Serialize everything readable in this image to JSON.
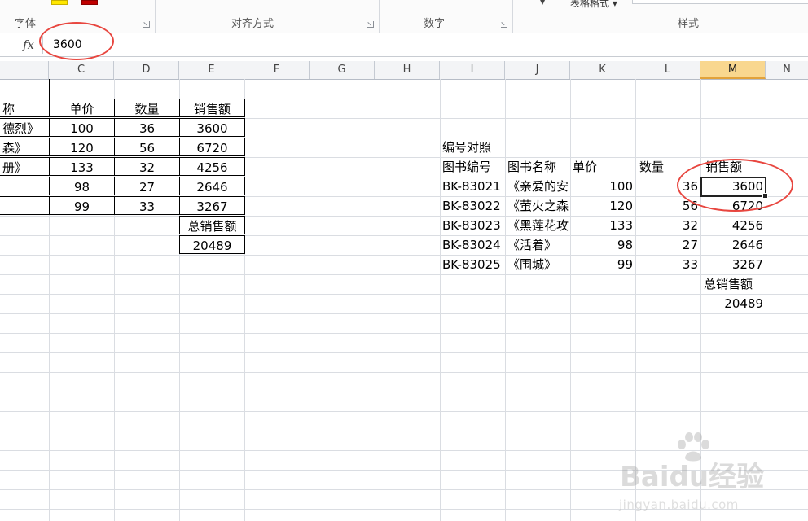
{
  "ribbon": {
    "groups": [
      {
        "label": "字体"
      },
      {
        "label": "对齐方式"
      },
      {
        "label": "数字"
      },
      {
        "label": "样式"
      }
    ],
    "table_style_label": "表格格式 ▾"
  },
  "formula_bar": {
    "fx_symbol": "fx",
    "value": "3600"
  },
  "columns": [
    "C",
    "D",
    "E",
    "F",
    "G",
    "H",
    "I",
    "J",
    "K",
    "L",
    "M",
    "N"
  ],
  "active_column": "M",
  "left_table": {
    "header_name": "称",
    "header_price": "单价",
    "header_qty": "数量",
    "header_sales": "销售额",
    "rows": [
      {
        "name": "德烈》",
        "price": "100",
        "qty": "36",
        "sales": "3600"
      },
      {
        "name": "森》",
        "price": "120",
        "qty": "56",
        "sales": "6720"
      },
      {
        "name": "册》",
        "price": "133",
        "qty": "32",
        "sales": "4256"
      },
      {
        "name": "",
        "price": "98",
        "qty": "27",
        "sales": "2646"
      },
      {
        "name": "",
        "price": "99",
        "qty": "33",
        "sales": "3267"
      }
    ],
    "total_label": "总销售额",
    "total_value": "20489"
  },
  "right_table": {
    "title": "编号对照",
    "header_id": "图书编号",
    "header_name": "图书名称",
    "header_price": "单价",
    "header_qty": "数量",
    "header_sales": "销售额",
    "rows": [
      {
        "id": "BK-83021",
        "name": "《亲爱的安",
        "price": "100",
        "qty": "36",
        "sales": "3600"
      },
      {
        "id": "BK-83022",
        "name": "《萤火之森",
        "price": "120",
        "qty": "56",
        "sales": "6720"
      },
      {
        "id": "BK-83023",
        "name": "《黑莲花攻",
        "price": "133",
        "qty": "32",
        "sales": "4256"
      },
      {
        "id": "BK-83024",
        "name": "《活着》",
        "price": "98",
        "qty": "27",
        "sales": "2646"
      },
      {
        "id": "BK-83025",
        "name": "《围城》",
        "price": "99",
        "qty": "33",
        "sales": "3267"
      }
    ],
    "total_label": "总销售额",
    "total_value": "20489"
  },
  "watermark": {
    "brand": "Baidu经验",
    "url": "jingyan.baidu.com"
  },
  "colors": {
    "annotation": "#e8463f",
    "active_header": "#f9d78f"
  }
}
